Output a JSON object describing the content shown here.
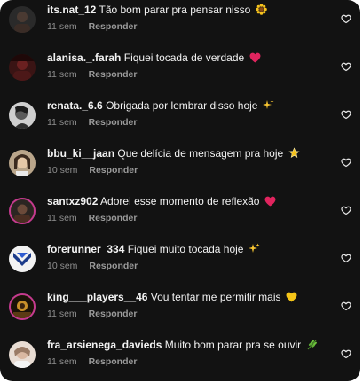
{
  "comments": [
    {
      "username": "its.nat_12",
      "text": "Tão bom parar pra pensar nisso",
      "emoji": "sunflower",
      "time": "11 sem",
      "reply": "Responder",
      "avatar": "dark"
    },
    {
      "username": "alanisa._.farah",
      "text": "Fiquei tocada de verdade",
      "emoji": "red-heart",
      "time": "11 sem",
      "reply": "Responder",
      "avatar": "red-dark"
    },
    {
      "username": "renata._6.6",
      "text": "Obrigada por lembrar disso hoje",
      "emoji": "sparkles",
      "time": "11 sem",
      "reply": "Responder",
      "avatar": "gray"
    },
    {
      "username": "bbu_ki__jaan",
      "text": "Que delícia de mensagem pra hoje",
      "emoji": "glowing-star",
      "time": "10 sem",
      "reply": "Responder",
      "avatar": "light"
    },
    {
      "username": "santxz902",
      "text": "Adorei esse momento de reflexão",
      "emoji": "red-heart",
      "time": "11 sem",
      "reply": "Responder",
      "avatar": "story"
    },
    {
      "username": "forerunner_334",
      "text": "Fiquei muito tocada hoje",
      "emoji": "sparkles",
      "time": "10 sem",
      "reply": "Responder",
      "avatar": "blue-logo"
    },
    {
      "username": "king___players__46",
      "text": "Vou tentar me permitir mais",
      "emoji": "yellow-heart",
      "time": "11 sem",
      "reply": "Responder",
      "avatar": "story-dark"
    },
    {
      "username": "fra_arsienega_davieds",
      "text": "Muito bom parar pra se ouvir",
      "emoji": "herb",
      "time": "11 sem",
      "reply": "Responder",
      "avatar": "pale"
    }
  ],
  "colors": {
    "background": "#121212",
    "text": "#f2f2f2",
    "muted": "#8e8e8e",
    "heart": "#e0245e",
    "yellow_heart": "#f5c518"
  },
  "icons": {
    "like": "heart-outline-icon"
  }
}
